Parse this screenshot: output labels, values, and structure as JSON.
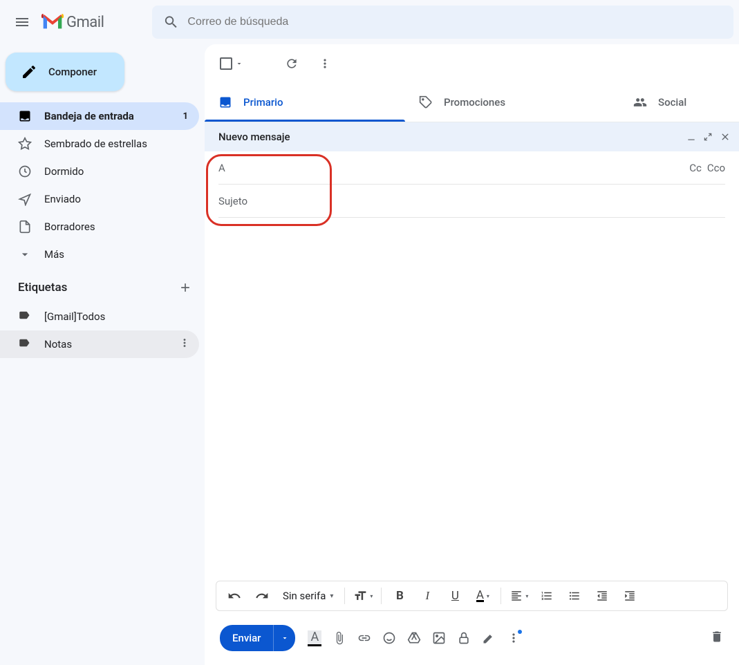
{
  "app": {
    "name": "Gmail"
  },
  "search": {
    "placeholder": "Correo de búsqueda"
  },
  "compose_button": {
    "label": "Componer"
  },
  "sidebar": {
    "items": [
      {
        "label": "Bandeja de entrada",
        "badge": "1"
      },
      {
        "label": "Sembrado de estrellas"
      },
      {
        "label": "Dormido"
      },
      {
        "label": "Enviado"
      },
      {
        "label": "Borradores"
      },
      {
        "label": "Más"
      }
    ],
    "labels_header": "Etiquetas",
    "labels": [
      {
        "label": "[Gmail]Todos"
      },
      {
        "label": "Notas"
      }
    ]
  },
  "tabs": {
    "primary": "Primario",
    "promotions": "Promociones",
    "social": "Social"
  },
  "compose": {
    "new_message": "Nuevo mensaje",
    "to_label": "A",
    "cc": "Cc",
    "bcc": "Cco",
    "subject_placeholder": "Sujeto",
    "font": "Sin serifa",
    "send": "Enviar"
  }
}
